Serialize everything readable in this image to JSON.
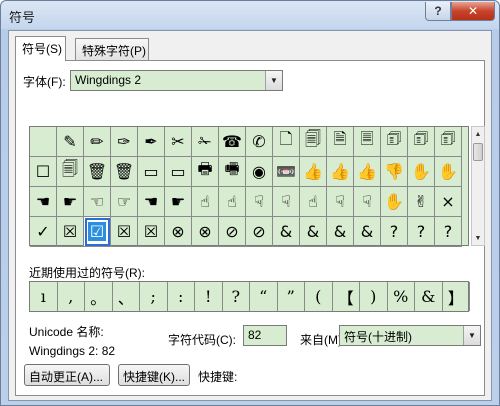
{
  "window": {
    "title": "符号",
    "help_label": "?",
    "close_label": "✕"
  },
  "tabs": [
    {
      "label": "符号(S)"
    },
    {
      "label": "特殊字符(P)"
    }
  ],
  "font": {
    "label": "字体(F):",
    "value": "Wingdings 2",
    "arrow": "▼"
  },
  "grid": {
    "rows": [
      [
        "",
        "✎",
        "✏",
        "✑",
        "✒",
        "✂",
        "✁",
        "☎",
        "✆",
        "🗋",
        "🗐",
        "🗎",
        "🗏",
        "🗊",
        "🗊",
        "🗊"
      ],
      [
        "☐",
        "🗐",
        "🗑",
        "🗑",
        "▭",
        "▭",
        "🖶",
        "🖷",
        "◉",
        "📼",
        "👍",
        "👍",
        "👍",
        "👎",
        "✋",
        "✋"
      ],
      [
        "☚",
        "☛",
        "☜",
        "☞",
        "☚",
        "☛",
        "☝",
        "☝",
        "☟",
        "☟",
        "☝",
        "☟",
        "☟",
        "✋",
        "✌",
        "×"
      ],
      [
        "✓",
        "☒",
        "☑",
        "☒",
        "☒",
        "⊗",
        "⊗",
        "⊘",
        "⊘",
        "&",
        "&",
        "&",
        "&",
        "?",
        "?",
        "?"
      ]
    ],
    "selected": {
      "row": 3,
      "col": 2
    }
  },
  "recent": {
    "label": "近期使用过的符号(R):",
    "symbols": [
      "ı",
      ",",
      "。",
      "、",
      ";",
      ":",
      "!",
      "?",
      "“",
      "”",
      "(",
      "【",
      ")",
      "%",
      "&",
      "】"
    ]
  },
  "unicode": {
    "name_label": "Unicode 名称:",
    "name_value": "Wingdings 2: 82"
  },
  "char_code": {
    "label": "字符代码(C):",
    "value": "82"
  },
  "from": {
    "label": "来自(M):",
    "value": "符号(十进制)",
    "arrow": "▼"
  },
  "buttons": {
    "autocorrect": "自动更正(A)...",
    "shortcut_key": "快捷键(K)..."
  },
  "shortcut": {
    "label": "快捷键:"
  }
}
